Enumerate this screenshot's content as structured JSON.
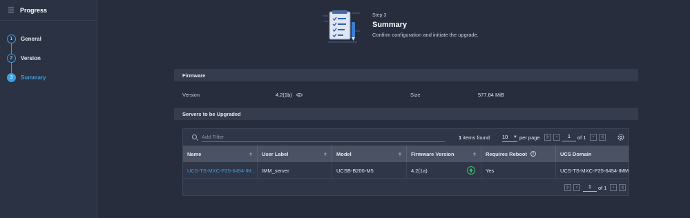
{
  "sidebar": {
    "title": "Progress",
    "steps": [
      {
        "num": "1",
        "label": "General"
      },
      {
        "num": "2",
        "label": "Version"
      },
      {
        "num": "3",
        "label": "Summary"
      }
    ]
  },
  "header": {
    "step": "Step 3",
    "title": "Summary",
    "description": "Confirm configuration and initiate the upgrade."
  },
  "firmware": {
    "heading": "Firmware",
    "version_label": "Version",
    "version_value": "4.2(1b)",
    "size_label": "Size",
    "size_value": "577.84 MiB"
  },
  "servers": {
    "heading": "Servers to be Upgraded",
    "filter_placeholder": "Add Filter",
    "items_count": "1",
    "items_found_label": "items found",
    "per_page_value": "10",
    "per_page_label": "per page",
    "page": "1",
    "of_pages": "of 1",
    "columns": [
      "Name",
      "User Label",
      "Model",
      "Firmware Version",
      "Requires Reboot",
      "UCS Domain"
    ],
    "rows": [
      [
        "UCS-TS-MXC-P25-6454-IM...",
        "IMM_server",
        "UCSB-B200-M5",
        "4.2(1a)",
        "Yes",
        "UCS-TS-MXC-P25-6454-IMM"
      ]
    ]
  },
  "colors": {
    "background": "#272d3d",
    "accent": "#3ba0e0",
    "upgrade_icon": "#3fbf6a"
  }
}
